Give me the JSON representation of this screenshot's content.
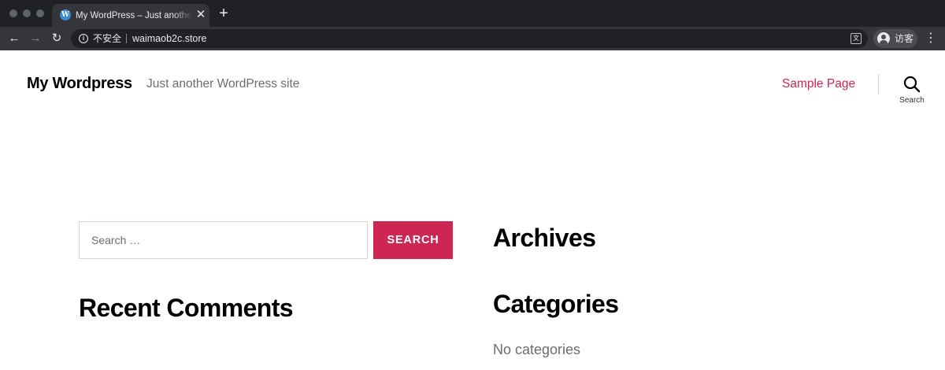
{
  "browser": {
    "tab": {
      "favicon": "wordpress-icon",
      "title": "My WordPress – Just another WordPress site",
      "close_label": "✕"
    },
    "new_tab_label": "+",
    "toolbar": {
      "back_label": "←",
      "forward_label": "→",
      "reload_label": "↻",
      "security_label": "不安全",
      "url": "waimaob2c.store",
      "translate_icon": "translate-icon",
      "profile_label": "访客",
      "menu_label": "⋮"
    },
    "colors": {
      "frame": "#202124",
      "toolbar": "#35363a"
    }
  },
  "site": {
    "title": "My Wordpress",
    "tagline": "Just another WordPress site",
    "nav": [
      {
        "label": "Sample Page"
      }
    ],
    "search_toggle_label": "Search",
    "accent_color": "#cd2653"
  },
  "widgets": {
    "search": {
      "placeholder": "Search …",
      "button_label": "SEARCH"
    },
    "recent_comments_title": "Recent Comments",
    "archives_title": "Archives",
    "categories_title": "Categories",
    "categories_empty": "No categories"
  }
}
